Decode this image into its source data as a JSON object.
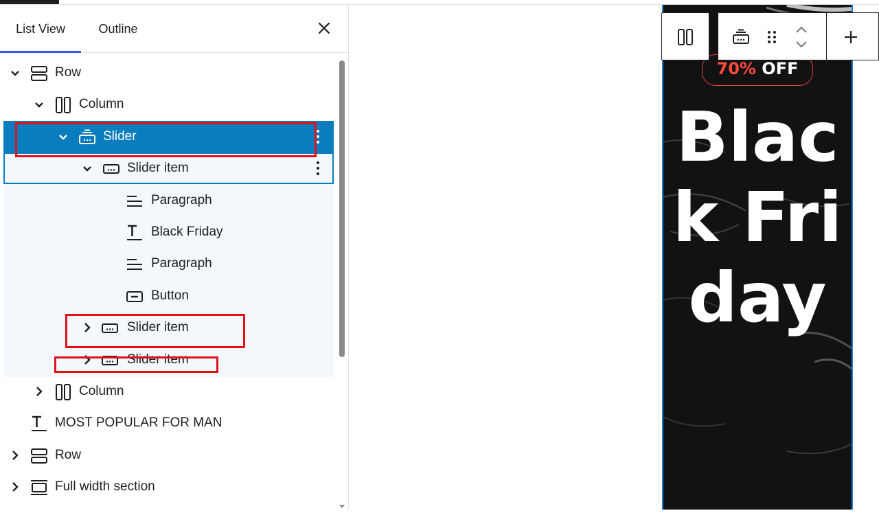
{
  "tabs": {
    "list_view": "List View",
    "outline": "Outline"
  },
  "tree": {
    "row1": "Row",
    "column1": "Column",
    "slider": "Slider",
    "slider_item_1": "Slider item",
    "paragraph_1": "Paragraph",
    "black_friday": "Black Friday",
    "paragraph_2": "Paragraph",
    "button": "Button",
    "slider_item_2": "Slider item",
    "slider_item_3": "Slider item",
    "column2": "Column",
    "most_popular": "MOST POPULAR FOR MAN",
    "row2": "Row",
    "full_width": "Full width section"
  },
  "canvas": {
    "badge_percent": "70%",
    "badge_off": " OFF",
    "hero_text": "Black Friday"
  },
  "colors": {
    "selected": "#0a7dbf",
    "highlight_red": "#e3101a",
    "tab_accent": "#3858e9",
    "hero_bg": "#121212",
    "badge_red": "#ff4a3d"
  },
  "icons": [
    "close-icon",
    "row-icon",
    "column-icon",
    "slider-icon",
    "slider-item-icon",
    "paragraph-icon",
    "heading-icon",
    "button-icon",
    "full-width-section-icon",
    "chevron-down-icon",
    "chevron-right-icon",
    "more-options-icon",
    "drag-handle-icon",
    "move-up-icon",
    "move-down-icon",
    "add-icon"
  ]
}
